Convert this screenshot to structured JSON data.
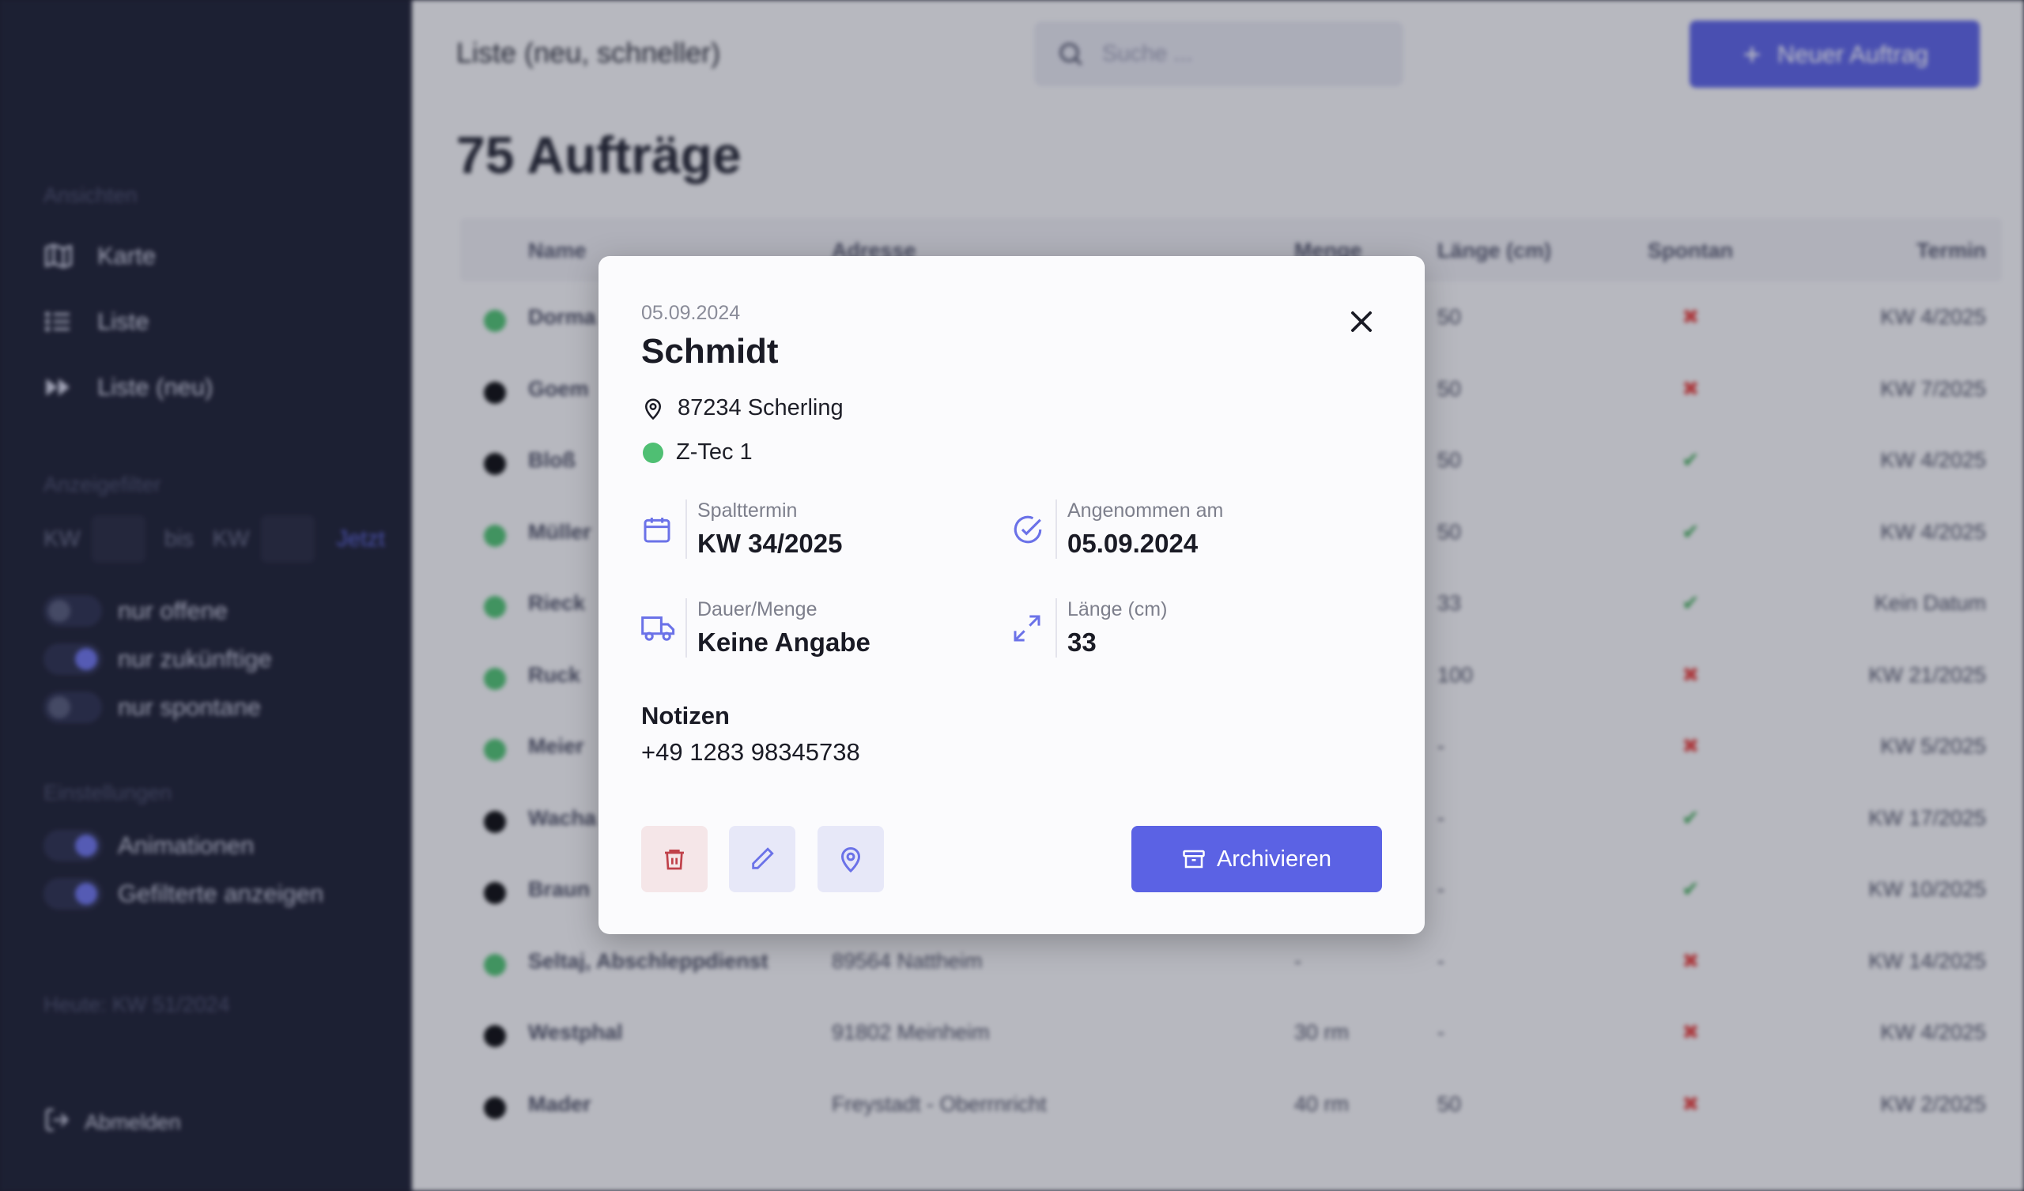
{
  "sidebar": {
    "section_views": "Ansichten",
    "nav": [
      {
        "label": "Karte",
        "icon": "map-icon"
      },
      {
        "label": "Liste",
        "icon": "list-icon"
      },
      {
        "label": "Liste (neu)",
        "icon": "fast-forward-icon"
      }
    ],
    "section_filter": "Anzeigefilter",
    "kw_from": "KW",
    "kw_to_sep": "bis",
    "kw_to": "KW",
    "kw_reset": "Jetzt",
    "toggles": [
      {
        "label": "nur offene",
        "on": false
      },
      {
        "label": "nur zukünftige",
        "on": true
      },
      {
        "label": "nur spontane",
        "on": false
      }
    ],
    "section_settings": "Einstellungen",
    "settings": [
      {
        "label": "Animationen",
        "on": true
      },
      {
        "label": "Gefilterte anzeigen",
        "on": true
      }
    ],
    "today": "Heute: KW 51/2024",
    "logout": "Abmelden"
  },
  "header": {
    "title": "Liste (neu, schneller)",
    "search_placeholder": "Suche ...",
    "new_order": "Neuer Auftrag"
  },
  "main": {
    "heading": "75 Aufträge",
    "columns": [
      "Name",
      "Adresse",
      "Menge",
      "Länge (cm)",
      "Spontan",
      "Termin"
    ],
    "rows": [
      {
        "status": "green",
        "name": "Dorma",
        "address": "",
        "qty": "",
        "len": "50",
        "spontan": false,
        "termin": "KW 4/2025"
      },
      {
        "status": "black",
        "name": "Goem",
        "address": "",
        "qty": "",
        "len": "50",
        "spontan": false,
        "termin": "KW 7/2025"
      },
      {
        "status": "black",
        "name": "Bloß",
        "address": "",
        "qty": "",
        "len": "50",
        "spontan": true,
        "termin": "KW 4/2025"
      },
      {
        "status": "green",
        "name": "Müller",
        "address": "",
        "qty": "",
        "len": "50",
        "spontan": true,
        "termin": "KW 4/2025"
      },
      {
        "status": "green",
        "name": "Rieck",
        "address": "",
        "qty": "",
        "len": "33",
        "spontan": true,
        "termin": "Kein Datum"
      },
      {
        "status": "green",
        "name": "Ruck",
        "address": "",
        "qty": "",
        "len": "100",
        "spontan": false,
        "termin": "KW 21/2025"
      },
      {
        "status": "green",
        "name": "Meier",
        "address": "",
        "qty": "",
        "len": "-",
        "spontan": false,
        "termin": "KW 5/2025"
      },
      {
        "status": "black",
        "name": "Wacha",
        "address": "",
        "qty": "",
        "len": "-",
        "spontan": true,
        "termin": "KW 17/2025"
      },
      {
        "status": "black",
        "name": "Braun",
        "address": "",
        "qty": "",
        "len": "-",
        "spontan": true,
        "termin": "KW 10/2025"
      },
      {
        "status": "green",
        "name": "Seltaj, Abschleppdienst",
        "address": "89564 Nattheim",
        "qty": "-",
        "len": "-",
        "spontan": false,
        "termin": "KW 14/2025"
      },
      {
        "status": "black",
        "name": "Westphal",
        "address": "91802 Meinheim",
        "qty": "30 rm",
        "len": "-",
        "spontan": false,
        "termin": "KW 4/2025"
      },
      {
        "status": "black",
        "name": "Mader",
        "address": "Freystadt - Oberrnricht",
        "qty": "40 rm",
        "len": "50",
        "spontan": false,
        "termin": "KW 2/2025"
      }
    ]
  },
  "modal": {
    "date": "05.09.2024",
    "title": "Schmidt",
    "address": "87234 Scherling",
    "team": "Z-Tec 1",
    "team_color": "#4fbf73",
    "info": [
      {
        "label": "Spalttermin",
        "value": "KW 34/2025",
        "icon": "calendar-icon"
      },
      {
        "label": "Angenommen am",
        "value": "05.09.2024",
        "icon": "check-circle-icon"
      },
      {
        "label": "Dauer/Menge",
        "value": "Keine Angabe",
        "icon": "truck-icon"
      },
      {
        "label": "Länge (cm)",
        "value": "33",
        "icon": "expand-icon"
      }
    ],
    "notes_label": "Notizen",
    "notes": "+49 1283 98345738",
    "archive": "Archivieren"
  },
  "colors": {
    "accent": "#5b62e4",
    "sidebar_bg": "#1d2035",
    "danger": "#e24545",
    "success": "#41a85a"
  }
}
